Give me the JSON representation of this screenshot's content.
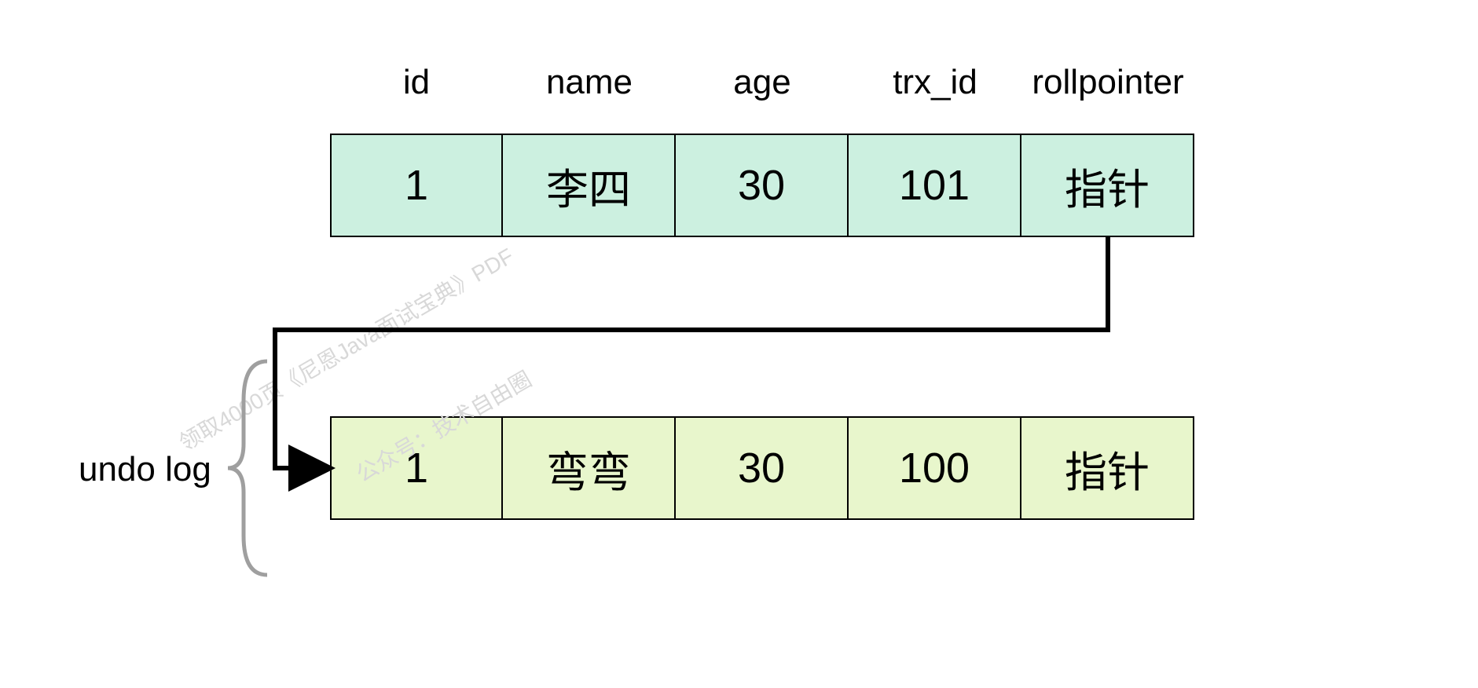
{
  "headers": {
    "id": "id",
    "name": "name",
    "age": "age",
    "trx_id": "trx_id",
    "rollpointer": "rollpointer"
  },
  "row1": {
    "id": "1",
    "name": "李四",
    "age": "30",
    "trx_id": "101",
    "rollpointer": "指针"
  },
  "row2": {
    "id": "1",
    "name": "弯弯",
    "age": "30",
    "trx_id": "100",
    "rollpointer": "指针"
  },
  "label_undo": "undo log",
  "watermark1": "领取4000页《尼恩Java面试宝典》PDF",
  "watermark2": "公众号：技术自由圈",
  "chart_data": {
    "type": "table",
    "title": "MVCC undo log version chain",
    "columns": [
      "id",
      "name",
      "age",
      "trx_id",
      "rollpointer"
    ],
    "current_row": {
      "id": 1,
      "name": "李四",
      "age": 30,
      "trx_id": 101,
      "rollpointer": "指针"
    },
    "undo_log": [
      {
        "id": 1,
        "name": "弯弯",
        "age": 30,
        "trx_id": 100,
        "rollpointer": "指针"
      }
    ],
    "pointer_from": "current_row.rollpointer",
    "pointer_to": "undo_log[0]"
  }
}
